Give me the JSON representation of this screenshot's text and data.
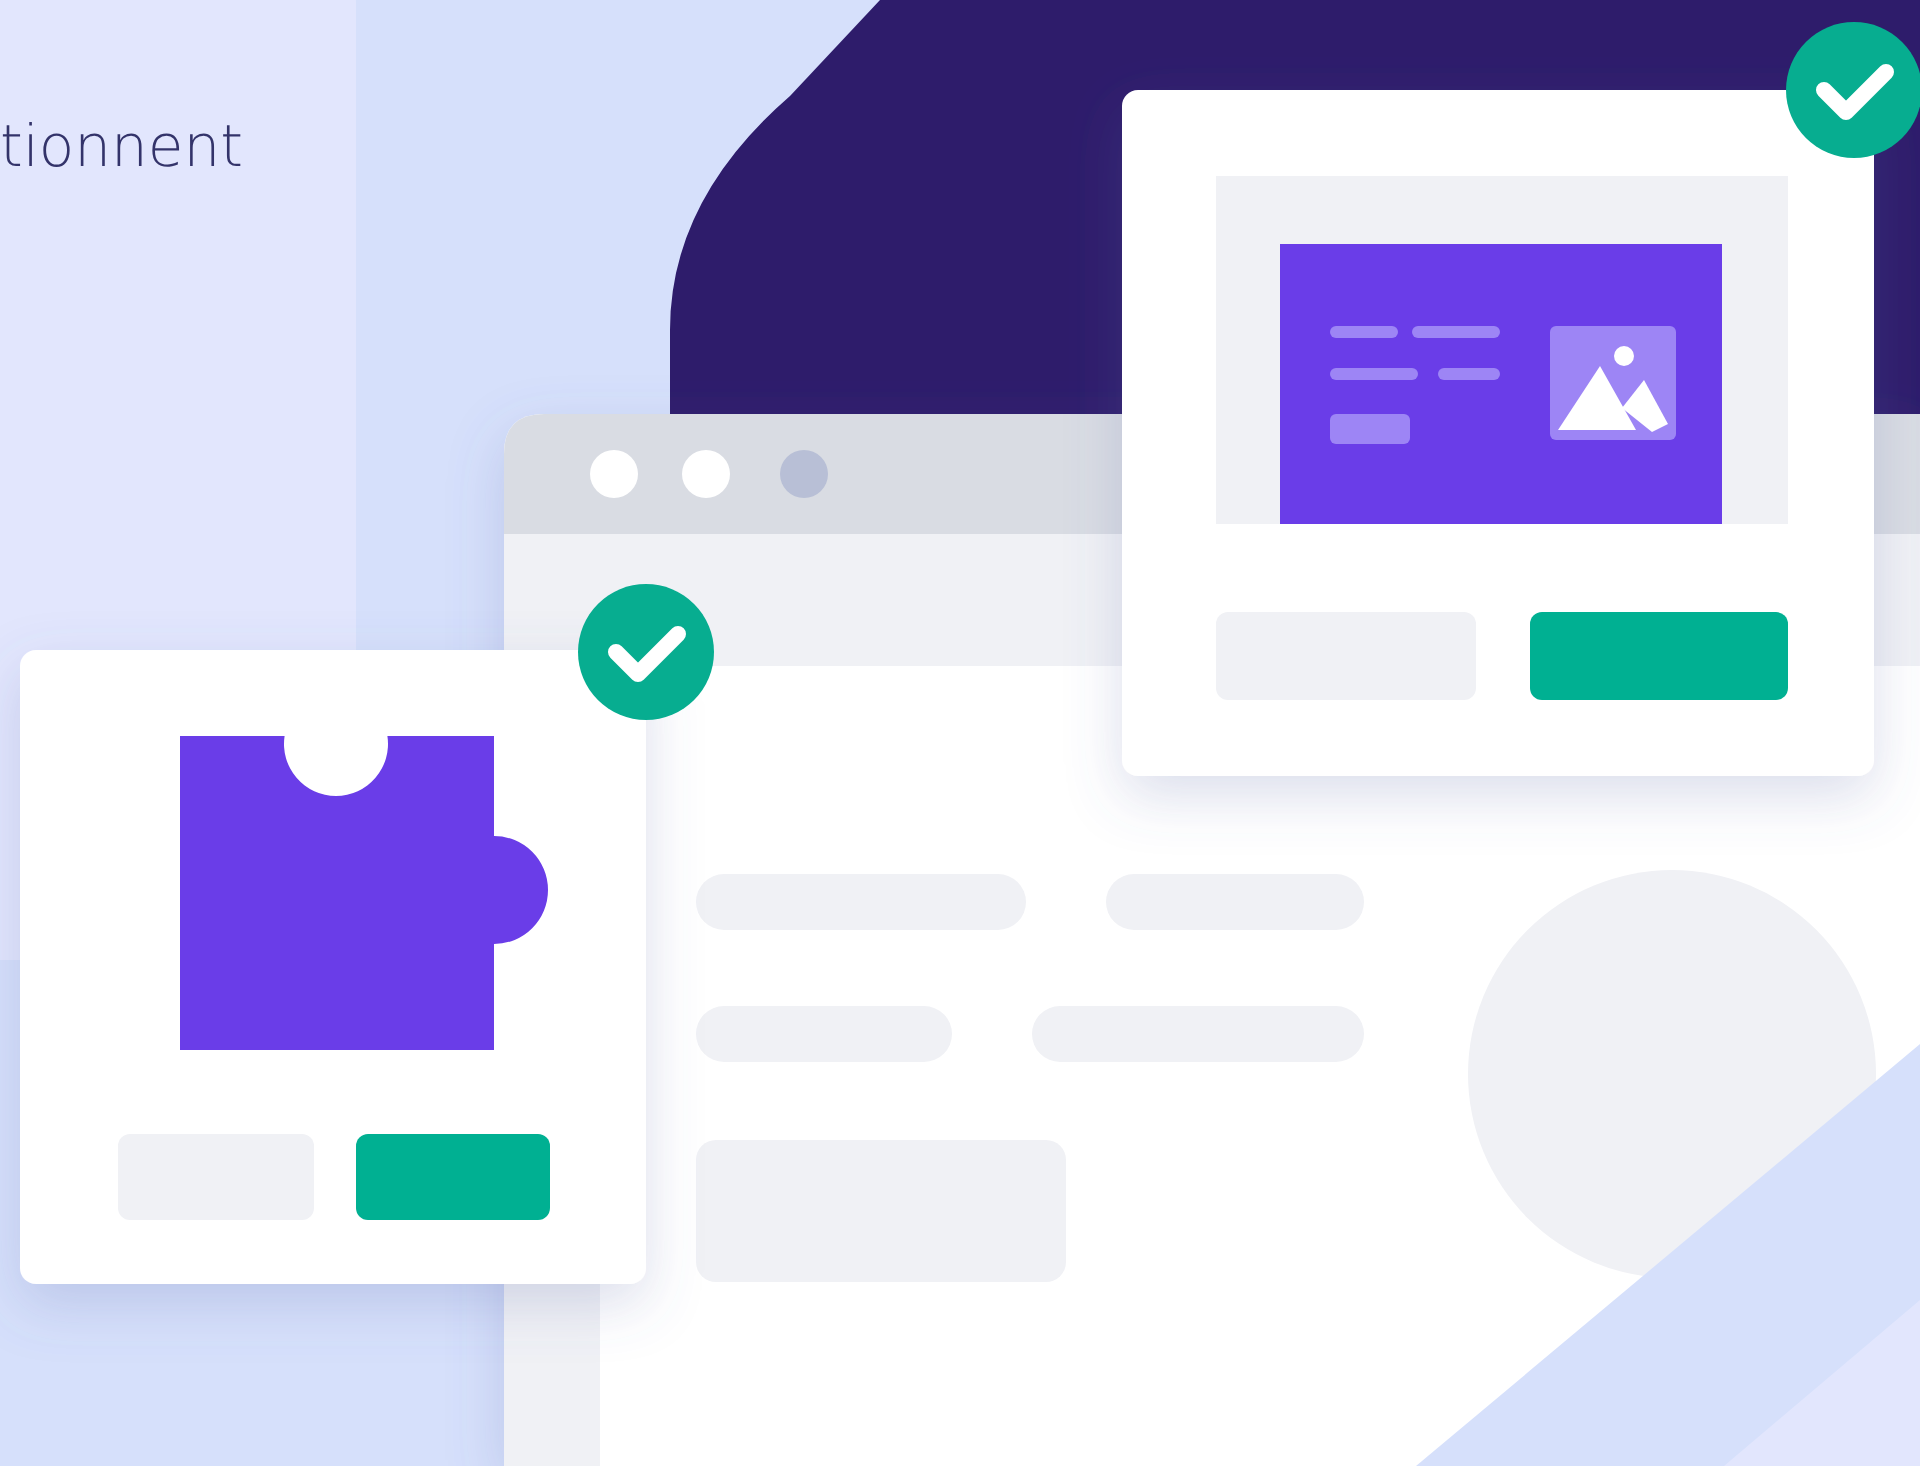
{
  "heading": "tionnent"
}
